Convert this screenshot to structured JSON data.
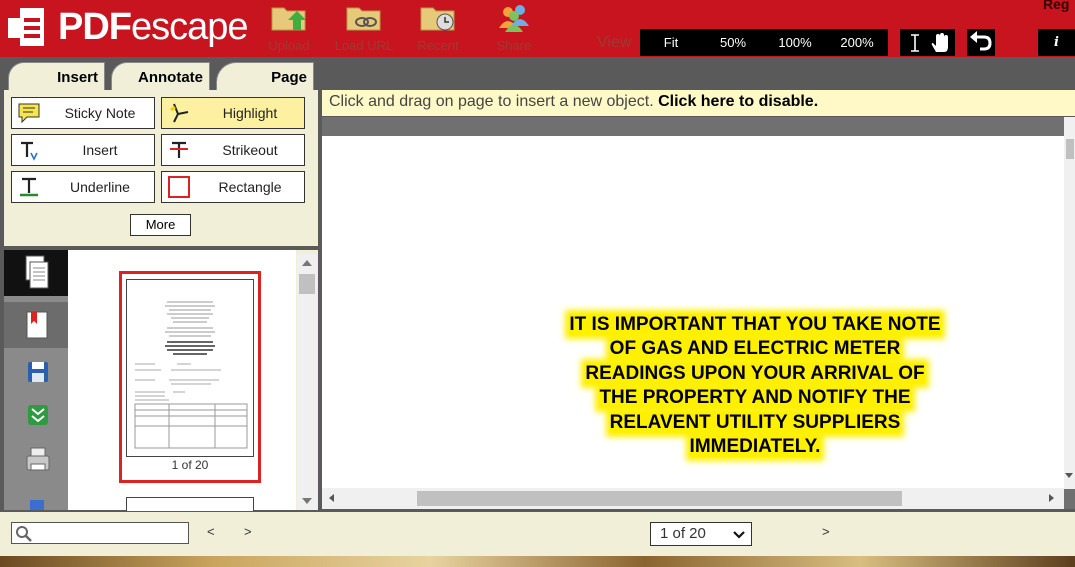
{
  "header": {
    "brand_prefix": "PDF",
    "brand_suffix": "escape",
    "buttons": [
      {
        "label": "Upload",
        "icon": "folder-upload-icon"
      },
      {
        "label": "Load URL",
        "icon": "folder-link-icon"
      },
      {
        "label": "Recent",
        "icon": "folder-clock-icon"
      },
      {
        "label": "Share",
        "icon": "people-icon"
      }
    ],
    "view_label": "View",
    "zoom_options": [
      "Fit",
      "50%",
      "100%",
      "200%"
    ],
    "info_label": "i",
    "reg_link": "Reg"
  },
  "tabs": [
    "Insert",
    "Annotate",
    "Page"
  ],
  "tools": [
    {
      "label": "Sticky Note",
      "icon": "sticky-note-icon"
    },
    {
      "label": "Highlight",
      "icon": "highlighter-icon",
      "active": true
    },
    {
      "label": "Insert",
      "icon": "text-insert-icon"
    },
    {
      "label": "Strikeout",
      "icon": "strikeout-icon"
    },
    {
      "label": "Underline",
      "icon": "underline-icon"
    },
    {
      "label": "Rectangle",
      "icon": "rectangle-icon"
    }
  ],
  "more_label": "More",
  "thumbnails": {
    "label": "1 of 20"
  },
  "notice": {
    "text": "Click and drag on page to insert a new object. ",
    "action": "Click here to disable."
  },
  "document": {
    "lines": [
      "IT IS IMPORTANT THAT YOU TAKE NOTE",
      "OF GAS AND ELECTRIC METER",
      "READINGS UPON YOUR ARRIVAL OF",
      "THE PROPERTY AND NOTIFY THE",
      "RELAVENT UTILITY SUPPLIERS",
      "IMMEDIATELY."
    ]
  },
  "bottom": {
    "prev": "<",
    "next": ">",
    "page_selector": "1 of 20",
    "page_next": ">"
  },
  "colors": {
    "brand_red": "#c8141e",
    "highlight": "#fff000",
    "panel": "#f2efd9",
    "thumb_border": "#dd2222"
  }
}
